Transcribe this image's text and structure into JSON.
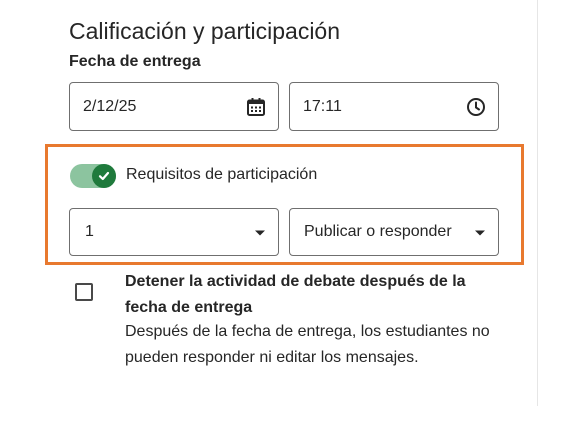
{
  "section": {
    "title": "Calificación y participación"
  },
  "due_date": {
    "label": "Fecha de entrega",
    "date_value": "2/12/25",
    "time_value": "17:11",
    "date_icon": "calendar-icon",
    "time_icon": "clock-icon"
  },
  "participation": {
    "toggle_label": "Requisitos de participación",
    "toggle_on": true,
    "count_value": "1",
    "type_value": "Publicar o responder",
    "highlight_color": "#e8792f",
    "toggle_color": "#1f7a3c"
  },
  "stop_activity": {
    "checked": false,
    "title": "Detener la actividad de debate después de la fecha de entrega",
    "description": "Después de la fecha de entrega, los estudiantes no pueden responder ni editar los mensajes."
  }
}
